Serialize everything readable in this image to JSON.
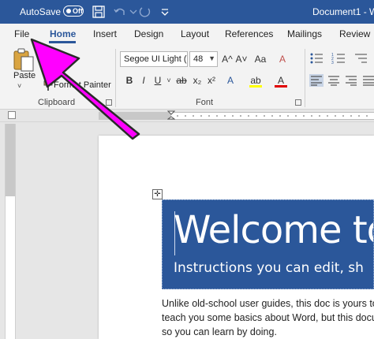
{
  "titlebar": {
    "autosave_label": "AutoSave",
    "autosave_state": "Off",
    "document_title": "Document1 - W"
  },
  "tabs": [
    {
      "label": "File"
    },
    {
      "label": "Home",
      "active": true
    },
    {
      "label": "Insert"
    },
    {
      "label": "Design"
    },
    {
      "label": "Layout"
    },
    {
      "label": "References"
    },
    {
      "label": "Mailings"
    },
    {
      "label": "Review"
    }
  ],
  "clipboard": {
    "paste_label": "Paste",
    "format_painter_label": "Format Painter",
    "group_label": "Clipboard"
  },
  "font": {
    "font_name": "Segoe UI Light (I",
    "font_size": "48",
    "group_label": "Font",
    "bold": "B",
    "italic": "I",
    "underline": "U",
    "strikethrough": "ab",
    "subscript": "x₂",
    "superscript": "x²",
    "grow": "A^",
    "shrink": "A˅",
    "change_case": "Aa",
    "clear_format": "A",
    "text_effects": "A",
    "highlight": "ab",
    "font_color": "A"
  },
  "document": {
    "banner_title": "Welcome to",
    "banner_subtitle": "Instructions you can edit, sh",
    "body_lines": [
      "Unlike old-school user guides, this doc is yours to",
      "teach you some basics about Word, but this docu",
      "so you can learn by doing."
    ]
  },
  "colors": {
    "brand": "#2b579a",
    "annotation_arrow": "#ff00ff"
  }
}
